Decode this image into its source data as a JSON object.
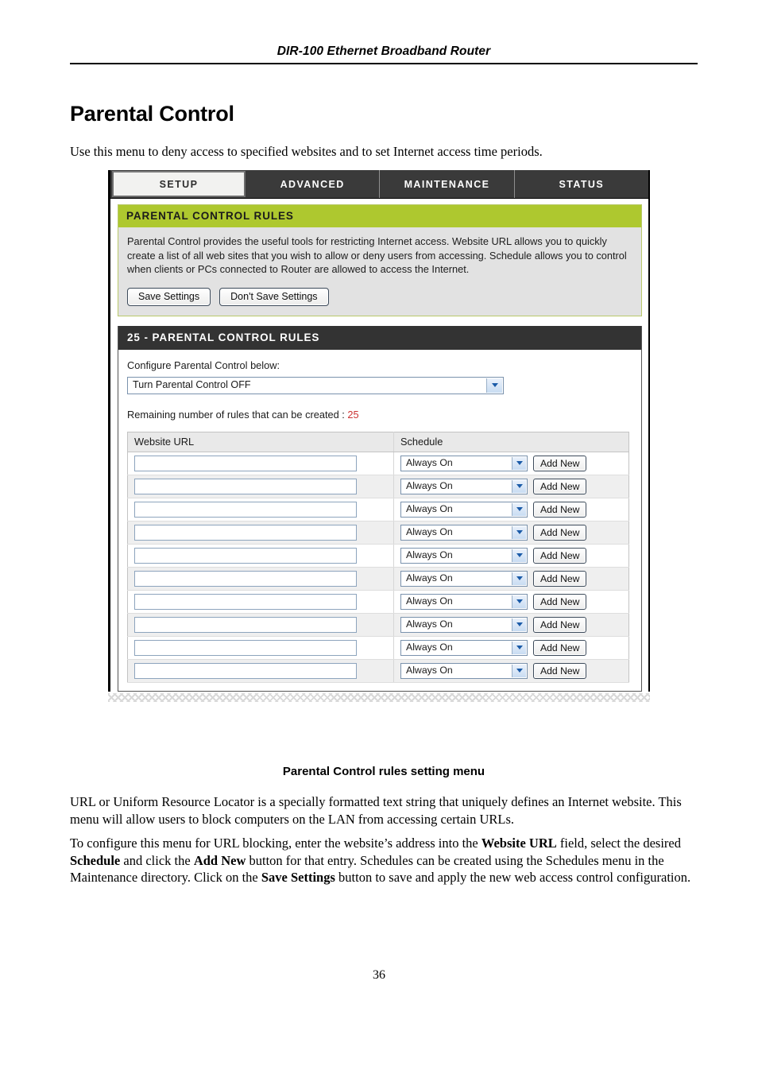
{
  "document": {
    "running_header": "DIR-100 Ethernet Broadband Router",
    "page_title": "Parental Control",
    "intro": "Use this menu to deny access to specified websites and to set Internet access time periods.",
    "figure_caption": "Parental Control rules setting menu",
    "paragraph_1": "URL or Uniform Resource Locator is a specially formatted text string that uniquely defines an Internet website. This menu will allow users to block computers on the LAN from accessing certain URLs.",
    "paragraph_2_parts": {
      "a": "To configure this menu for URL blocking, enter the website’s address into the ",
      "b_bold": "Website URL",
      "c": " field, select the desired ",
      "d_bold": "Schedule",
      "e": " and click the ",
      "f_bold": "Add New",
      "g": " button for that entry. Schedules can be created using the Schedules menu in the Maintenance directory. Click on the ",
      "h_bold": "Save Settings",
      "i": " button to save and apply the new web access control configuration."
    },
    "page_number": "36"
  },
  "router_ui": {
    "tabs": [
      {
        "label": "SETUP",
        "active": true
      },
      {
        "label": "ADVANCED",
        "active": false
      },
      {
        "label": "MAINTENANCE",
        "active": false
      },
      {
        "label": "STATUS",
        "active": false
      }
    ],
    "info_card": {
      "heading": "PARENTAL CONTROL RULES",
      "description": "Parental Control provides the useful tools for restricting Internet access. Website URL allows you to quickly create a list of all web sites that you wish to allow or deny users from accessing. Schedule allows you to control when clients or PCs connected to Router are allowed to access the Internet.",
      "save_label": "Save Settings",
      "dont_save_label": "Don't Save Settings"
    },
    "rules_card": {
      "heading": "25 - PARENTAL CONTROL RULES",
      "configure_label": "Configure Parental Control below:",
      "mode_select_value": "Turn Parental Control OFF",
      "remaining_label": "Remaining number of rules that can be created : ",
      "remaining_count": "25",
      "table": {
        "headers": [
          "Website URL",
          "Schedule"
        ],
        "rows": [
          {
            "url": "",
            "schedule": "Always On",
            "add_label": "Add New"
          },
          {
            "url": "",
            "schedule": "Always On",
            "add_label": "Add New"
          },
          {
            "url": "",
            "schedule": "Always On",
            "add_label": "Add New"
          },
          {
            "url": "",
            "schedule": "Always On",
            "add_label": "Add New"
          },
          {
            "url": "",
            "schedule": "Always On",
            "add_label": "Add New"
          },
          {
            "url": "",
            "schedule": "Always On",
            "add_label": "Add New"
          },
          {
            "url": "",
            "schedule": "Always On",
            "add_label": "Add New"
          },
          {
            "url": "",
            "schedule": "Always On",
            "add_label": "Add New"
          },
          {
            "url": "",
            "schedule": "Always On",
            "add_label": "Add New"
          },
          {
            "url": "",
            "schedule": "Always On",
            "add_label": "Add New"
          }
        ]
      }
    },
    "colors": {
      "accent_green": "#aec82f",
      "dark_bar": "#333333",
      "tab_bar": "#3a3a3a",
      "count_red": "#cc3333"
    }
  }
}
